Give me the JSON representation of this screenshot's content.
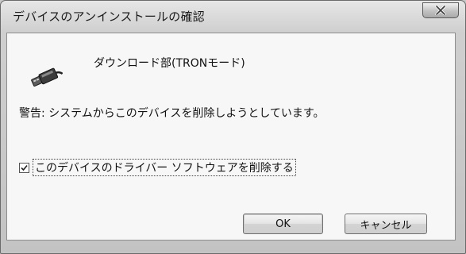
{
  "window": {
    "title": "デバイスのアンインストールの確認",
    "close_symbol": "x"
  },
  "dialog": {
    "device_name": "ダウンロード部(TRONモード)",
    "device_icon": "usb-connector-icon",
    "warning": "警告: システムからこのデバイスを削除しようとしています。",
    "checkbox": {
      "label": "このデバイスのドライバー ソフトウェアを削除する",
      "checked": true
    },
    "buttons": {
      "ok": "OK",
      "cancel": "キャンセル"
    }
  }
}
